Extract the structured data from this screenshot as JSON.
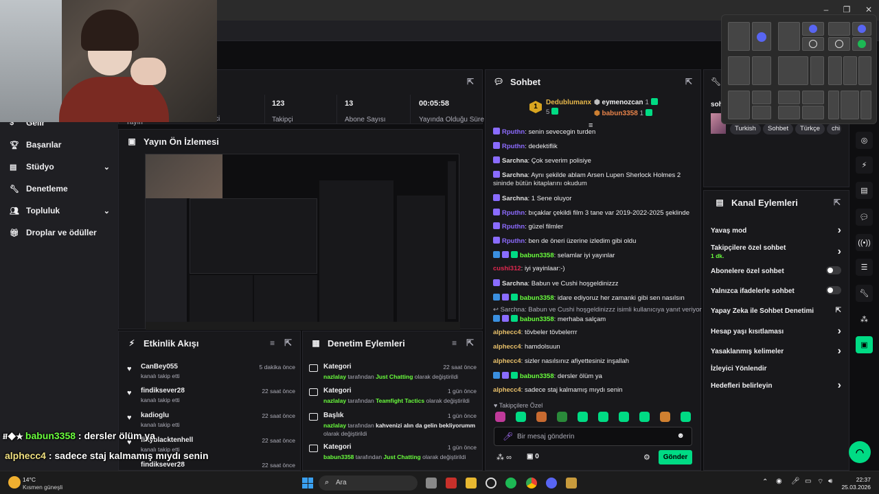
{
  "window": {
    "minimize": "–",
    "restore": "❐",
    "close": "✕"
  },
  "nav": {
    "items": [
      {
        "label": "Gelir",
        "icon": "dollar-icon",
        "chevron": false
      },
      {
        "label": "Başarılar",
        "icon": "trophy-icon",
        "chevron": false
      },
      {
        "label": "Stüdyo",
        "icon": "studio-icon",
        "chevron": true
      },
      {
        "label": "Denetleme",
        "icon": "wrench-icon",
        "chevron": false
      },
      {
        "label": "Topluluk",
        "icon": "community-icon",
        "chevron": true
      },
      {
        "label": "Droplar ve ödüller",
        "icon": "gift-icon",
        "chevron": false
      }
    ]
  },
  "stats": {
    "left_partial_1": "Yayın",
    "left_partial_2": "ci",
    "items": [
      {
        "value": "123",
        "label": "Takipçi"
      },
      {
        "value": "13",
        "label": "Abone Sayısı"
      },
      {
        "value": "00:05:58",
        "label": "Yayında Olduğu Süre"
      }
    ]
  },
  "preview": {
    "title": "Yayın Ön İzlemesi"
  },
  "chat": {
    "title": "Sohbet",
    "leaderboard": {
      "rank": "1",
      "first": {
        "name": "Dedublumanx",
        "count": "5"
      },
      "second": {
        "name": "eymenozcan",
        "count": "1"
      },
      "third": {
        "name": "babun3358",
        "count": "1"
      }
    },
    "messages": [
      {
        "user": "Rputhn",
        "color": "#8d6bff",
        "text": ": senin sevecegin turden",
        "badges": [
          "star"
        ]
      },
      {
        "user": "Rputhn",
        "color": "#8d6bff",
        "text": ": dedektiflik",
        "badges": [
          "star"
        ]
      },
      {
        "user": "Sarchna",
        "color": "#e0e0e0",
        "text": ": Çok severim polisiye",
        "badges": [
          "star"
        ]
      },
      {
        "user": "Sarchna",
        "color": "#e0e0e0",
        "text": ": Aynı şekilde ablam Arsen Lupen Sherlock Holmes 2",
        "badges": [
          "star"
        ]
      },
      {
        "user": "",
        "color": "#e0e0e0",
        "text": "sininde bütün kitaplarını okudum",
        "badges": []
      },
      {
        "user": "Sarchna",
        "color": "#e0e0e0",
        "text": ": 1 Sene oluyor",
        "badges": [
          "star"
        ]
      },
      {
        "user": "Rputhn",
        "color": "#8d6bff",
        "text": ": bıçaklar çekildi film 3 tane var 2019-2022-2025 şeklinde",
        "badges": [
          "star"
        ]
      },
      {
        "user": "Rputhn",
        "color": "#8d6bff",
        "text": ": güzel filmler",
        "badges": [
          "star"
        ]
      },
      {
        "user": "Rputhn",
        "color": "#8d6bff",
        "text": ": ben de öneri üzerine izledim gibi oldu",
        "badges": [
          "star"
        ]
      },
      {
        "user": "babun3358",
        "color": "#6aff3d",
        "text": ": selamlar iyi yayınlar",
        "badges": [
          "blue",
          "star",
          "green"
        ]
      },
      {
        "user": "cushi312",
        "color": "#e0284f",
        "text": ": iyi yayinlaar:-)",
        "badges": []
      },
      {
        "user": "Sarchna",
        "color": "#e0e0e0",
        "text": ": Babun ve Cushi hoşgeldinizzz",
        "badges": [
          "star"
        ]
      },
      {
        "user": "babun3358",
        "color": "#6aff3d",
        "text": ": idare ediyoruz her zamanki gibi sen nasılsın",
        "badges": [
          "blue",
          "star",
          "green"
        ]
      },
      {
        "user": "",
        "color": "#adadb8",
        "text": "↩ Sarchna: Babun ve Cushi hoşgeldinizzz isimli kullanıcıya yanıt veriyor",
        "badges": []
      },
      {
        "user": "babun3358",
        "color": "#6aff3d",
        "text": ": merhaba salçam",
        "badges": [
          "blue",
          "star",
          "green"
        ]
      },
      {
        "user": "alphecc4",
        "color": "#e8c06a",
        "text": ": tövbeler tövbelerrr",
        "badges": []
      },
      {
        "user": "alphecc4",
        "color": "#e8c06a",
        "text": ": hamdolsuun",
        "badges": []
      },
      {
        "user": "alphecc4",
        "color": "#e8c06a",
        "text": ": sizler nasılsınız afiyettesiniz inşallah",
        "badges": []
      },
      {
        "user": "babun3358",
        "color": "#6aff3d",
        "text": ": dersler ölüm ya",
        "badges": [
          "blue",
          "star",
          "green"
        ]
      },
      {
        "user": "alphecc4",
        "color": "#e8c06a",
        "text": ": sadece staj kalmamış mıydı senin",
        "badges": []
      }
    ],
    "followers_only": "Takipçilere Özel",
    "input_placeholder": "Bir mesaj gönderin",
    "points": "∞",
    "gift_count": "0",
    "send": "Gönder"
  },
  "activity": {
    "title": "Etkinlik Akışı",
    "rows": [
      {
        "name": "CanBey055",
        "sub": "kanalı takip etti",
        "time": "5 dakika önce"
      },
      {
        "name": "findiksever28",
        "sub": "kanalı takip etti",
        "time": "22 saat önce"
      },
      {
        "name": "kadioglu",
        "sub": "kanalı takip etti",
        "time": "22 saat önce"
      },
      {
        "name": "fiftyblacktenhell",
        "sub": "kanalı takip etti",
        "time": "22 saat önce"
      },
      {
        "name": "findiksever28",
        "sub": "",
        "time": "22 saat önce"
      }
    ]
  },
  "modlog": {
    "title": "Denetim Eylemleri",
    "rows": [
      {
        "kind": "Kategori",
        "by": "nazlalay",
        "mid": " tarafından ",
        "target": "Just Chatting",
        "end": " olarak değiştirildi",
        "line2": "",
        "time": "22 saat önce"
      },
      {
        "kind": "Kategori",
        "by": "nazlalay",
        "mid": " tarafından ",
        "target": "Teamfight Tactics",
        "end": " olarak değiştirildi",
        "line2": "",
        "time": "1 gün önce"
      },
      {
        "kind": "Başlık",
        "by": "nazlalay",
        "mid": " tarafından ",
        "target": "kahvenizi alın da gelin bekliyorumm",
        "end": "",
        "line2": "olarak değiştirildi",
        "time": "1 gün önce"
      },
      {
        "kind": "Kategori",
        "by": "babun3358",
        "mid": " tarafından ",
        "target": "Just Chatting",
        "end": " olarak değiştirildi",
        "line2": "",
        "time": "1 gün önce"
      }
    ]
  },
  "channel": {
    "title_partial": "soh",
    "tags": [
      "Turkish",
      "Sohbet",
      "Türkçe",
      "chi"
    ]
  },
  "actions": {
    "title": "Kanal Eylemleri",
    "rows": [
      {
        "label": "Yavaş mod",
        "control": "chevron",
        "sub": ""
      },
      {
        "label": "Takipçilere özel sohbet",
        "control": "chevron",
        "sub": "1 dk."
      },
      {
        "label": "Abonelere özel sohbet",
        "control": "toggle",
        "sub": ""
      },
      {
        "label": "Yalnızca ifadelerle sohbet",
        "control": "toggle",
        "sub": ""
      },
      {
        "label": "Yapay Zeka ile Sohbet Denetimi",
        "control": "external",
        "sub": ""
      },
      {
        "label": "Hesap yaşı kısıtlaması",
        "control": "chevron",
        "sub": ""
      },
      {
        "label": "Yasaklanmış kelimeler",
        "control": "chevron",
        "sub": ""
      },
      {
        "label": "İzleyici Yönlendir",
        "control": "none",
        "sub": ""
      },
      {
        "label": "Hedefleri belirleyin",
        "control": "chevron",
        "sub": ""
      }
    ]
  },
  "overlay": {
    "line1_user": "babun3358",
    "line1_text": " : dersler ölüm ya",
    "line2_user": "alphecc4",
    "line2_text": " : sadece staj kalmamış mıydı senin"
  },
  "taskbar": {
    "temp": "14°C",
    "weather": "Kısmen güneşli",
    "search": "Ara",
    "time": "22:37",
    "date": "25.03.2026"
  },
  "colors": {
    "accent_green": "#00db84",
    "lime": "#6aff3d",
    "panel": "#18181b",
    "bg": "#0e0e10"
  }
}
